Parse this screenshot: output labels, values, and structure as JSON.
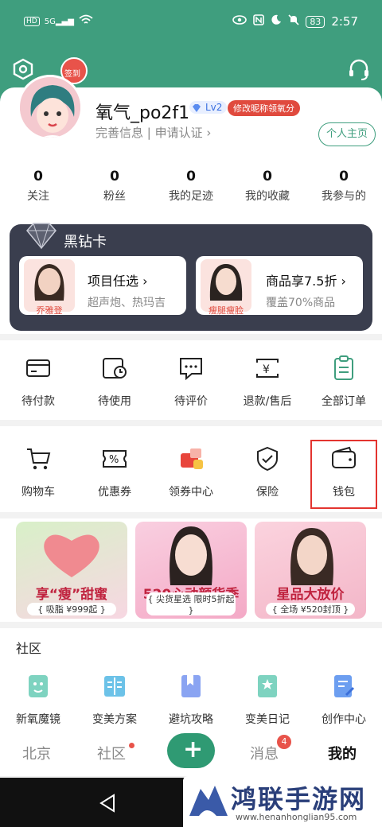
{
  "status_bar": {
    "hd": "HD",
    "signal": "5G",
    "battery": "83",
    "time": "2:57"
  },
  "header": {
    "sign_in_label": "签到"
  },
  "profile": {
    "username": "氧气_po2f1",
    "level": "Lv2",
    "modify_tag": "修改昵称领氧分",
    "sub_info": "完善信息 | 申请认证",
    "homepage_button": "个人主页"
  },
  "stats": [
    {
      "value": "0",
      "label": "关注"
    },
    {
      "value": "0",
      "label": "粉丝"
    },
    {
      "value": "0",
      "label": "我的足迹"
    },
    {
      "value": "0",
      "label": "我的收藏"
    },
    {
      "value": "0",
      "label": "我参与的"
    }
  ],
  "vip": {
    "title": "黑钻卡",
    "cards": [
      {
        "face_tag": "乔雅登",
        "heading": "项目任选",
        "sub": "超声炮、热玛吉"
      },
      {
        "face_tag": "瘦腿瘦脸",
        "heading": "商品享7.5折",
        "sub": "覆盖70%商品"
      }
    ]
  },
  "orders": [
    {
      "label": "待付款",
      "icon": "card-icon"
    },
    {
      "label": "待使用",
      "icon": "clock-card-icon"
    },
    {
      "label": "待评价",
      "icon": "comment-icon"
    },
    {
      "label": "退款/售后",
      "icon": "refund-icon"
    },
    {
      "label": "全部订单",
      "icon": "clipboard-icon"
    }
  ],
  "services": [
    {
      "label": "购物车",
      "icon": "cart-icon"
    },
    {
      "label": "优惠券",
      "icon": "coupon-icon"
    },
    {
      "label": "领券中心",
      "icon": "gift-icon"
    },
    {
      "label": "保险",
      "icon": "shield-icon"
    },
    {
      "label": "钱包",
      "icon": "wallet-icon"
    }
  ],
  "promos": [
    {
      "title": "享“瘦”甜蜜",
      "sub": "{ 吸脂 ¥999起 }"
    },
    {
      "title": "520心动颜货季",
      "sub": "{ 尖货星选 限时5折起 }"
    },
    {
      "title": "星品大放价",
      "sub": "{ 全场 ¥520封顶 }"
    }
  ],
  "community": {
    "title": "社区",
    "tools": [
      {
        "label": "新氧魔镜",
        "icon": "face-scan-icon"
      },
      {
        "label": "变美方案",
        "icon": "book-icon"
      },
      {
        "label": "避坑攻略",
        "icon": "bookmark-icon"
      },
      {
        "label": "变美日记",
        "icon": "diary-icon"
      },
      {
        "label": "创作中心",
        "icon": "edit-doc-icon"
      }
    ]
  },
  "tabbar": {
    "beijing": "北京",
    "community": "社区",
    "plus": "+",
    "messages": "消息",
    "messages_badge": "4",
    "mine": "我的"
  },
  "watermark": {
    "title": "鸿联手游网",
    "url": "www.henanhonglian95.com"
  },
  "colors": {
    "brand_green": "#3f9e7e",
    "alert_red": "#e04a3e",
    "vip_dark": "#3a3e4e"
  }
}
